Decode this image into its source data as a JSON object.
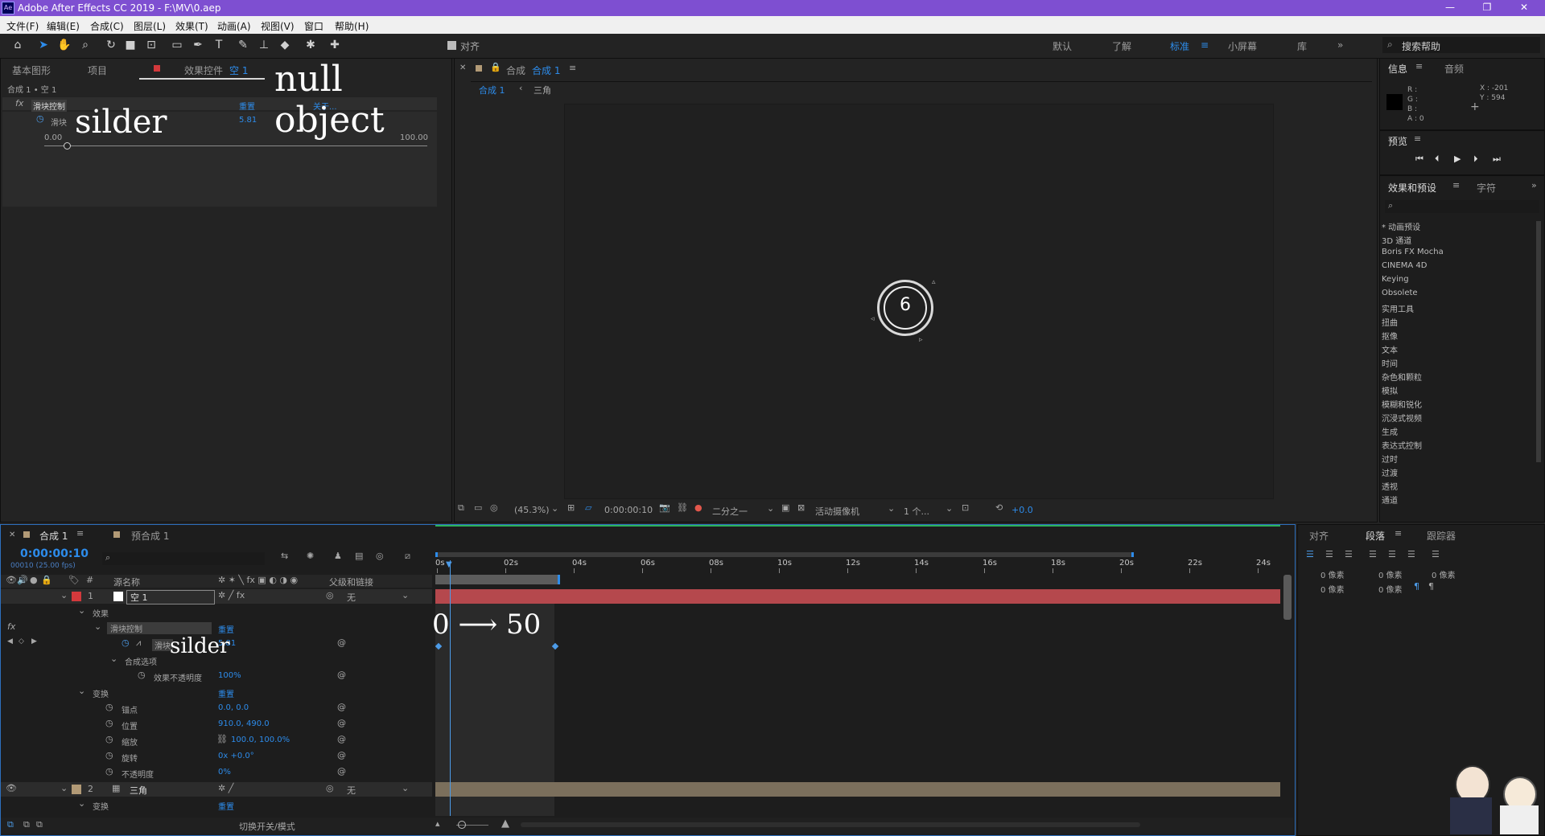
{
  "app": {
    "title": "Adobe After Effects CC 2019 - F:\\MV\\0.aep",
    "icon_label": "Ae",
    "window_controls": [
      "minimize-icon",
      "restore-icon",
      "close-icon"
    ]
  },
  "menu": [
    "文件(F)",
    "编辑(E)",
    "合成(C)",
    "图层(L)",
    "效果(T)",
    "动画(A)",
    "视图(V)",
    "窗口",
    "帮助(H)"
  ],
  "toolbar": {
    "tools": [
      "home-icon",
      "selection-icon",
      "hand-icon",
      "zoom-icon",
      "rotate-icon",
      "camera-icon",
      "pan-behind-icon",
      "rectangle-icon",
      "pen-icon",
      "type-icon",
      "brush-icon",
      "clone-stamp-icon",
      "eraser-icon",
      "roto-brush-icon",
      "puppet-pin-icon"
    ],
    "snap_label": "对齐",
    "workspaces": [
      "默认",
      "了解",
      "标准",
      "小屏幕",
      "库"
    ],
    "active_workspace": "标准",
    "search_help": "搜索帮助"
  },
  "effect_controls": {
    "tabs": [
      "基本图形",
      "项目",
      "效果控件",
      "空 1"
    ],
    "breadcrumb": "合成 1 • 空 1",
    "effect_name": "滑块控制",
    "reset": "重置",
    "about": "关于...",
    "param_name": "滑块",
    "param_value": "5.81",
    "slider_min": "0.00",
    "slider_max": "100.00",
    "slider_value": 5.81
  },
  "annotations": {
    "null_object": "null object",
    "slider_top": "silder",
    "slider_timeline": "silder",
    "range": "0 ⟶ 50"
  },
  "composition": {
    "header_prefix": "合成",
    "header_name": "合成 1",
    "tabs": [
      "合成 1",
      "三角"
    ],
    "counter_value": "6",
    "zoom": "(45.3%)",
    "timecode": "0:00:00:10",
    "resolution": "二分之一",
    "camera": "活动摄像机",
    "views": "1 个...",
    "exposure": "+0.0"
  },
  "info_panel": {
    "tabs": [
      "信息",
      "音频"
    ],
    "rgba": [
      "R :",
      "G :",
      "B :",
      "A : 0"
    ],
    "x": "X : -201",
    "y": "Y : 594"
  },
  "preview_panel": {
    "title": "预览",
    "controls": [
      "first-frame-icon",
      "prev-frame-icon",
      "play-icon",
      "next-frame-icon",
      "last-frame-icon"
    ]
  },
  "effects_presets": {
    "tabs": [
      "效果和预设",
      "字符"
    ],
    "items": [
      "* 动画预设",
      "3D 通道",
      "Boris FX Mocha",
      "CINEMA 4D",
      "Keying",
      "Obsolete",
      "实用工具",
      "扭曲",
      "抠像",
      "文本",
      "时间",
      "杂色和颗粒",
      "模拟",
      "模糊和锐化",
      "沉浸式视频",
      "生成",
      "表达式控制",
      "过时",
      "过渡",
      "透视",
      "通道"
    ]
  },
  "timeline": {
    "tabs": [
      "合成 1",
      "预合成 1"
    ],
    "timecode": "0:00:00:10",
    "timecode_sub": "00010 (25.00 fps)",
    "columns": [
      "源名称",
      "父级和链接"
    ],
    "ruler": [
      "0s",
      "02s",
      "04s",
      "06s",
      "08s",
      "10s",
      "12s",
      "14s",
      "16s",
      "18s",
      "20s",
      "22s",
      "24s"
    ],
    "layers": [
      {
        "num": "1",
        "name": "空 1",
        "parent": "无",
        "color": "#d3393c"
      },
      {
        "num": "2",
        "name": "三角",
        "parent": "无",
        "color": "#b29a76"
      }
    ],
    "rows": [
      {
        "label": "效果",
        "value": ""
      },
      {
        "label": "滑块控制",
        "value": "重置"
      },
      {
        "label": "滑块",
        "value": "5.81"
      },
      {
        "label": "合成选项",
        "value": ""
      },
      {
        "label": "效果不透明度",
        "value": "100%"
      },
      {
        "label": "变换",
        "value": "重置"
      },
      {
        "label": "锚点",
        "value": "0.0, 0.0"
      },
      {
        "label": "位置",
        "value": "910.0, 490.0"
      },
      {
        "label": "缩放",
        "value": "100.0, 100.0%"
      },
      {
        "label": "旋转",
        "value": "0x +0.0°"
      },
      {
        "label": "不透明度",
        "value": "0%"
      },
      {
        "label": "变换",
        "value": "重置"
      }
    ],
    "footer": "切换开关/模式"
  },
  "paragraph_panel": {
    "tabs": [
      "对齐",
      "段落",
      "跟踪器"
    ],
    "fields": [
      "0 像素",
      "0 像素",
      "0 像素",
      "0 像素",
      "0 像素"
    ]
  },
  "colors": {
    "accent": "#2d8ceb",
    "title_bar": "#7e4fd1",
    "layer1_bar": "#b5484d",
    "layer2_bar": "#7b6f5c"
  }
}
